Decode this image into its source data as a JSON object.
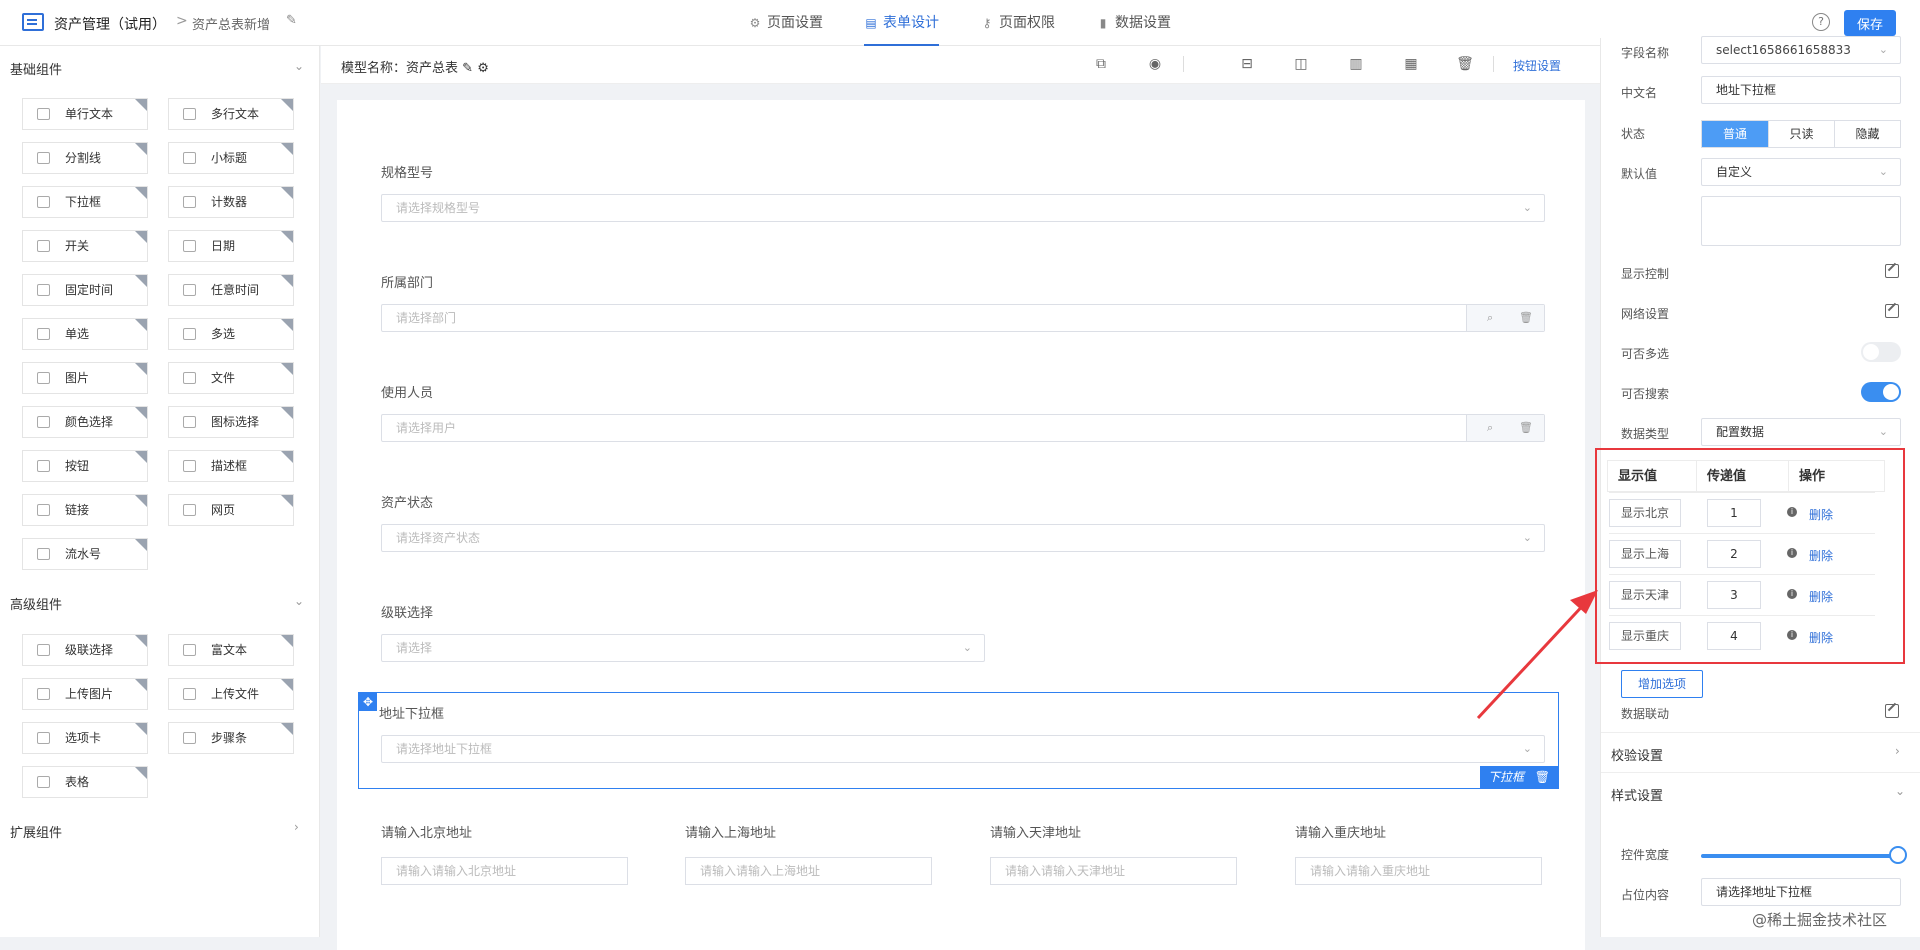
{
  "header": {
    "app_title": "资产管理（试用）",
    "crumb_sep": ">",
    "breadcrumb": "资产总表新增",
    "tabs": [
      "页面设置",
      "表单设计",
      "页面权限",
      "数据设置"
    ],
    "help": "?",
    "save_label": "保存"
  },
  "left_panel": {
    "basic_title": "基础组件",
    "basic": [
      "单行文本",
      "多行文本",
      "分割线",
      "小标题",
      "下拉框",
      "计数器",
      "开关",
      "日期",
      "固定时间",
      "任意时间",
      "单选",
      "多选",
      "图片",
      "文件",
      "颜色选择",
      "图标选择",
      "按钮",
      "描述框",
      "链接",
      "网页",
      "流水号"
    ],
    "advanced_title": "高级组件",
    "advanced": [
      "级联选择",
      "富文本",
      "上传图片",
      "上传文件",
      "选项卡",
      "步骤条",
      "表格"
    ],
    "extended_title": "扩展组件"
  },
  "toolbar": {
    "model_name": "模型名称：资产总表",
    "button_settings": "按钮设置"
  },
  "form": {
    "fields": [
      {
        "label": "规格型号",
        "placeholder": "请选择规格型号"
      },
      {
        "label": "所属部门",
        "placeholder": "请选择部门"
      },
      {
        "label": "使用人员",
        "placeholder": "请选择用户"
      },
      {
        "label": "资产状态",
        "placeholder": "请选择资产状态"
      },
      {
        "label": "级联选择",
        "placeholder": "请选择"
      },
      {
        "label": "地址下拉框",
        "placeholder": "请选择地址下拉框"
      }
    ],
    "selected_tag": "下拉框",
    "address": [
      {
        "label": "请输入北京地址",
        "placeholder": "请输入请输入北京地址"
      },
      {
        "label": "请输入上海地址",
        "placeholder": "请输入请输入上海地址"
      },
      {
        "label": "请输入天津地址",
        "placeholder": "请输入请输入天津地址"
      },
      {
        "label": "请输入重庆地址",
        "placeholder": "请输入请输入重庆地址"
      }
    ]
  },
  "props": {
    "field_name_label": "字段名称",
    "field_name": "select1658661658833",
    "cn_name_label": "中文名",
    "cn_name": "地址下拉框",
    "status_label": "状态",
    "status_options": [
      "普通",
      "只读",
      "隐藏"
    ],
    "default_label": "默认值",
    "default_value": "自定义",
    "display_ctrl": "显示控制",
    "grid_settings": "网络设置",
    "multi_label": "可否多选",
    "multi_on": false,
    "search_label": "可否搜索",
    "search_on": true,
    "data_type_label": "数据类型",
    "data_type": "配置数据",
    "options_table": {
      "headers": [
        "显示值",
        "传递值",
        "操作"
      ],
      "rows": [
        {
          "display": "显示北京",
          "value": "1",
          "action": "删除"
        },
        {
          "display": "显示上海",
          "value": "2",
          "action": "删除"
        },
        {
          "display": "显示天津",
          "value": "3",
          "action": "删除"
        },
        {
          "display": "显示重庆",
          "value": "4",
          "action": "删除"
        }
      ],
      "add_label": "增加选项"
    },
    "linkage": "数据联动",
    "validation": "校验设置",
    "style": "样式设置",
    "width_label": "控件宽度",
    "width_pct": 100,
    "placeholder_label": "占位内容",
    "placeholder_value": "请选择地址下拉框"
  },
  "watermark": "@稀土掘金技术社区",
  "colors": {
    "accent": "#2f80f0",
    "highlight": "#e8383d"
  }
}
